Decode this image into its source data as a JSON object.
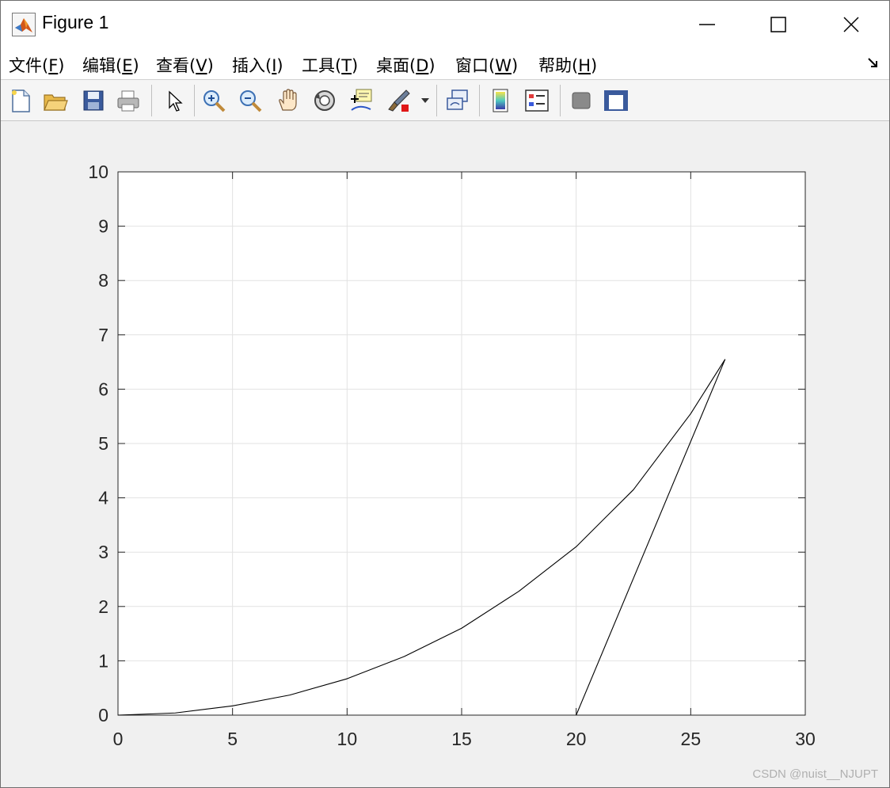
{
  "window": {
    "title": "Figure 1",
    "icon": "matlab-icon",
    "buttons": [
      "minimize-icon",
      "maximize-icon",
      "close-icon"
    ]
  },
  "menu": {
    "items": [
      {
        "label": "文件(",
        "key": "F",
        "tail": ")"
      },
      {
        "label": "编辑(",
        "key": "E",
        "tail": ")"
      },
      {
        "label": "查看(",
        "key": "V",
        "tail": ")"
      },
      {
        "label": "插入(",
        "key": "I",
        "tail": ")"
      },
      {
        "label": "工具(",
        "key": "T",
        "tail": ")"
      },
      {
        "label": "桌面(",
        "key": "D",
        "tail": ")"
      },
      {
        "label": "窗口(",
        "key": "W",
        "tail": ")"
      },
      {
        "label": "帮助(",
        "key": "H",
        "tail": ")"
      }
    ]
  },
  "toolbar": {
    "icons": [
      "new-figure-icon",
      "open-file-icon",
      "save-icon",
      "print-icon",
      "select-arrow-icon",
      "zoom-in-icon",
      "zoom-out-icon",
      "pan-hand-icon",
      "rotate-3d-icon",
      "data-cursor-icon",
      "brush-icon",
      "brush-dropdown-icon",
      "link-plot-icon",
      "colorbar-icon",
      "legend-icon",
      "hide-plot-tools-icon",
      "show-plot-tools-icon"
    ]
  },
  "chart_data": {
    "type": "line",
    "title": "",
    "xlabel": "",
    "ylabel": "",
    "xlim": [
      0,
      30
    ],
    "ylim": [
      0,
      10
    ],
    "xticks": [
      0,
      5,
      10,
      15,
      20,
      25,
      30
    ],
    "yticks": [
      0,
      1,
      2,
      3,
      4,
      5,
      6,
      7,
      8,
      9,
      10
    ],
    "grid": true,
    "line_color": "#000000",
    "series": [
      {
        "x": [
          0,
          2.5,
          5,
          7.5,
          10,
          12.5,
          15,
          17.5,
          20,
          22.5,
          25,
          26.5
        ],
        "y": [
          0,
          0.04,
          0.17,
          0.37,
          0.67,
          1.08,
          1.6,
          2.28,
          3.1,
          4.15,
          5.55,
          6.55
        ]
      },
      {
        "x": [
          20,
          26.5
        ],
        "y": [
          0,
          6.55
        ]
      }
    ]
  },
  "watermark": "CSDN @nuist__NJUPT"
}
